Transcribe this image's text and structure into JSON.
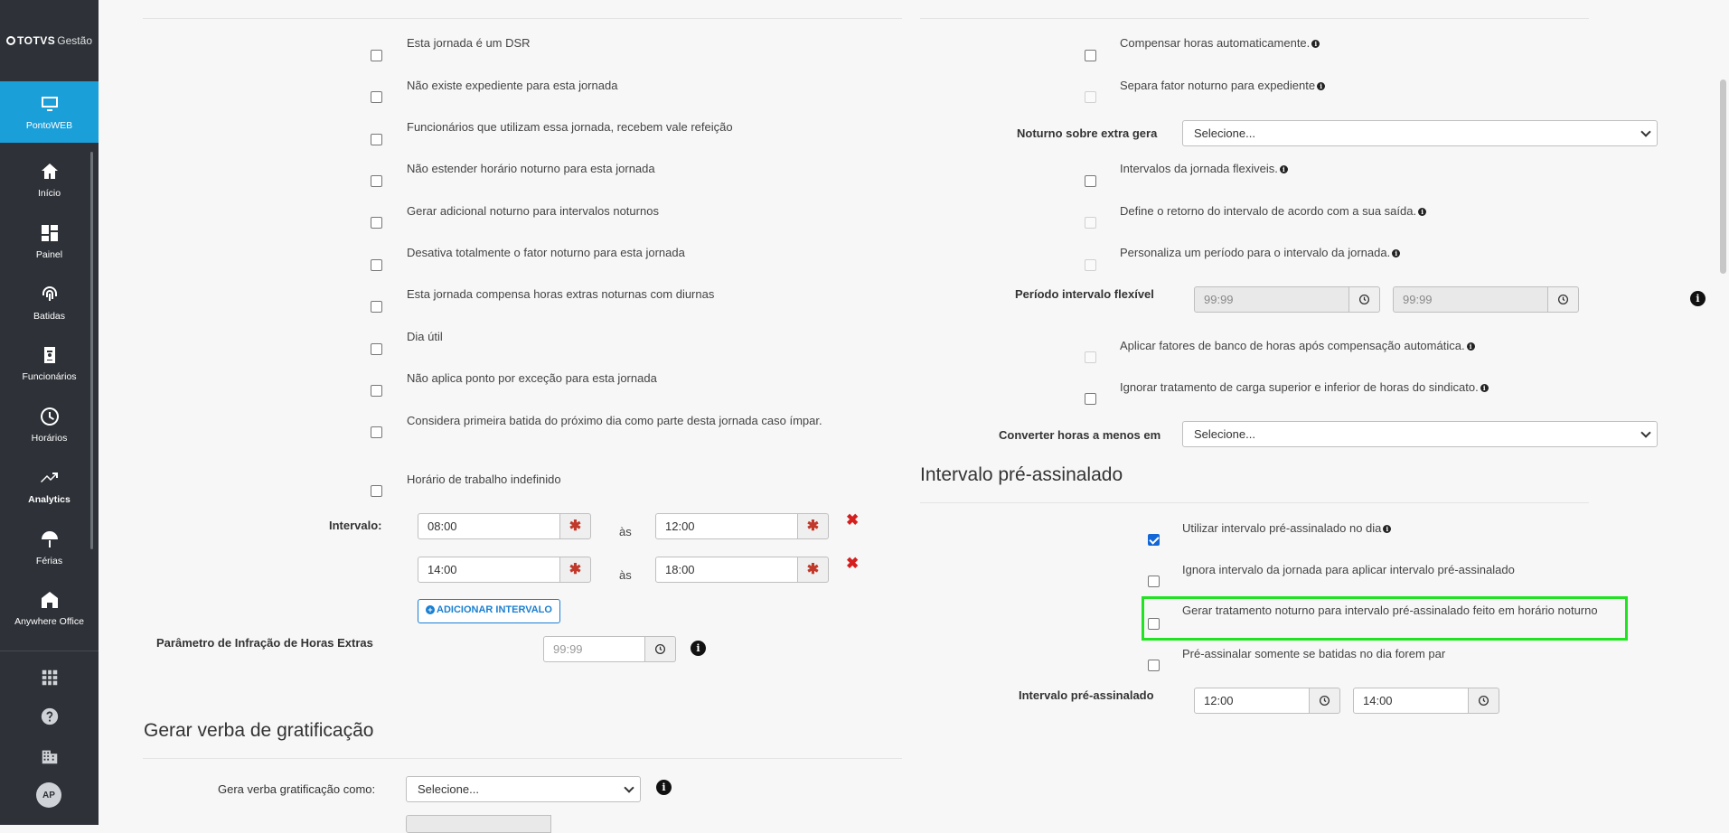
{
  "sidebar": {
    "logo_brand": "TOTVS",
    "logo_sub": "Gestão",
    "items": [
      {
        "label": "PontoWEB"
      },
      {
        "label": "Início"
      },
      {
        "label": "Painel"
      },
      {
        "label": "Batidas"
      },
      {
        "label": "Funcionários"
      },
      {
        "label": "Horários"
      },
      {
        "label": "Analytics"
      },
      {
        "label": "Férias"
      },
      {
        "label": "Anywhere Office"
      }
    ],
    "avatar": "AP"
  },
  "left": {
    "checkboxes": [
      {
        "label": "Esta jornada é um DSR",
        "checked": false
      },
      {
        "label": "Não existe expediente para esta jornada",
        "checked": false
      },
      {
        "label": "Funcionários que utilizam essa jornada, recebem vale refeição",
        "checked": false
      },
      {
        "label": "Não estender horário noturno para esta jornada",
        "checked": false
      },
      {
        "label": "Gerar adicional noturno para intervalos noturnos",
        "checked": false
      },
      {
        "label": "Desativa totalmente o fator noturno para esta jornada",
        "checked": false
      },
      {
        "label": "Esta jornada compensa horas extras noturnas com diurnas",
        "checked": false
      },
      {
        "label": "Dia útil",
        "checked": false
      },
      {
        "label": "Não aplica ponto por exceção para esta jornada",
        "checked": false
      },
      {
        "label": "Considera primeira batida do próximo dia como parte desta jornada caso ímpar.",
        "checked": false
      },
      {
        "label": "Horário de trabalho indefinido",
        "checked": false
      }
    ],
    "intervalo_label": "Intervalo:",
    "as_label": "às",
    "intervals": [
      {
        "start": "08:00",
        "end": "12:00"
      },
      {
        "start": "14:00",
        "end": "18:00"
      }
    ],
    "add_interval_label": "ADICIONAR INTERVALO",
    "param_infracao_label": "Parâmetro de Infração de Horas Extras",
    "param_infracao_placeholder": "99:99",
    "gratificacao_title": "Gerar verba de gratificação",
    "gera_verba_label": "Gera verba gratificação como:",
    "gera_verba_value": "Selecione..."
  },
  "right": {
    "compensar_label": "Compensar horas automaticamente.",
    "separa_fator_label": "Separa fator noturno para expediente",
    "noturno_extra_label": "Noturno sobre extra gera",
    "noturno_extra_value": "Selecione...",
    "intervalos_flex_label": "Intervalos da jornada flexiveis.",
    "define_retorno_label": "Define o retorno do intervalo de acordo com a sua saída.",
    "personaliza_label": "Personaliza um período para o intervalo da jornada.",
    "periodo_flex_label": "Período intervalo flexível",
    "periodo_flex_start": "99:99",
    "periodo_flex_end": "99:99",
    "aplicar_fatores_label": "Aplicar fatores de banco de horas após compensação automática.",
    "ignorar_carga_label": "Ignorar tratamento de carga superior e inferior de horas do sindicato.",
    "converter_label": "Converter horas a menos em",
    "converter_value": "Selecione...",
    "pre_assinalado_title": "Intervalo pré-assinalado",
    "utilizar_pre_label": "Utilizar intervalo pré-assinalado no dia",
    "ignora_intervalo_label": "Ignora intervalo da jornada para aplicar intervalo pré-assinalado",
    "gerar_tratamento_label": "Gerar tratamento noturno para intervalo pré-assinalado feito em horário noturno",
    "pre_assinalar_par_label": "Pré-assinalar somente se batidas no dia forem par",
    "intervalo_pre_label": "Intervalo pré-assinalado",
    "intervalo_pre_start": "12:00",
    "intervalo_pre_end": "14:00"
  },
  "colors": {
    "sidebar_bg": "#2e3238",
    "active_blue": "#1a9fd9",
    "highlight_green": "#21e321",
    "delete_red": "#d51f1f"
  }
}
